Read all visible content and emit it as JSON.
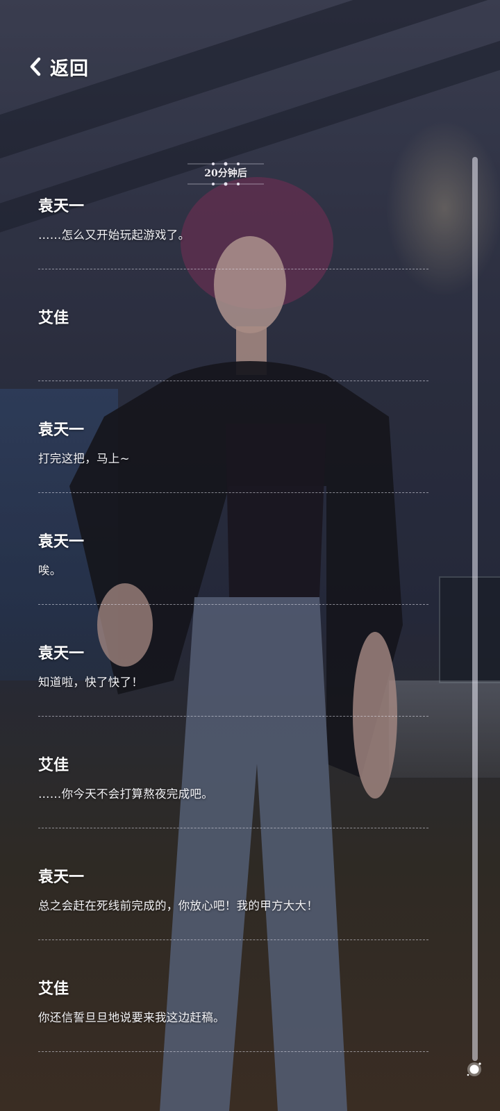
{
  "header": {
    "back_label": "返回",
    "back_icon": "chevron-left-icon"
  },
  "time_marker": {
    "text": "20分钟后"
  },
  "dialogue": [
    {
      "speaker": "袁天一",
      "text": "……怎么又开始玩起游戏了。"
    },
    {
      "speaker": "艾佳",
      "text": ""
    },
    {
      "speaker": "袁天一",
      "text": "打完这把，马上~"
    },
    {
      "speaker": "袁天一",
      "text": "唉。"
    },
    {
      "speaker": "袁天一",
      "text": "知道啦，快了快了！"
    },
    {
      "speaker": "艾佳",
      "text": "……你今天不会打算熬夜完成吧。"
    },
    {
      "speaker": "袁天一",
      "text": "总之会赶在死线前完成的，你放心吧！我的甲方大大！"
    },
    {
      "speaker": "艾佳",
      "text": "你还信誓旦旦地说要来我这边赶稿。"
    }
  ],
  "scrollbar": {
    "position": "bottom"
  },
  "colors": {
    "text": "#ffffff",
    "divider": "#e6e6f0",
    "scroll_track": "#ebebf5"
  }
}
